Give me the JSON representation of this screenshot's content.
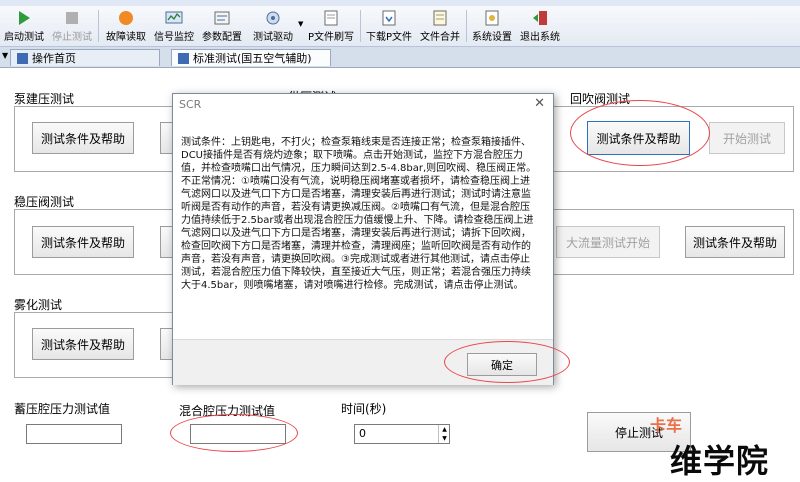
{
  "toolbar": {
    "buttons": [
      {
        "label": "启动测试",
        "icon": "play-icon"
      },
      {
        "label": "停止测试",
        "icon": "stop-icon"
      },
      {
        "label": "故障读取",
        "icon": "fault-read-icon"
      },
      {
        "label": "信号监控",
        "icon": "signal-monitor-icon"
      },
      {
        "label": "参数配置",
        "icon": "param-config-icon"
      },
      {
        "label": "测试驱动",
        "icon": "test-drive-icon"
      },
      {
        "label": "P文件刷写",
        "icon": "pfile-flash-icon"
      },
      {
        "label": "下载P文件",
        "icon": "download-icon"
      },
      {
        "label": "文件合并",
        "icon": "file-merge-icon"
      },
      {
        "label": "系统设置",
        "icon": "settings-icon"
      },
      {
        "label": "退出系统",
        "icon": "exit-icon"
      }
    ]
  },
  "tabs": {
    "home": "操作首页",
    "standard": "标准测试(国五空气辅助)"
  },
  "groups": {
    "pump": {
      "title": "泵建压测试",
      "help_btn": "测试条件及帮助"
    },
    "pressure_hidden": {
      "title": "供压测试"
    },
    "purge": {
      "title": "回吹阀测试",
      "help_btn": "测试条件及帮助",
      "start_btn": "开始测试"
    },
    "regulator": {
      "title": "稳压阀测试",
      "help_btn": "测试条件及帮助"
    },
    "flow": {
      "start_btn": "大流量测试开始",
      "help_btn": "测试条件及帮助"
    },
    "atomize": {
      "title": "雾化测试",
      "help_btn": "测试条件及帮助"
    }
  },
  "bottom": {
    "accum_label": "蓄压腔压力测试值",
    "accum_value": "",
    "mix_label": "混合腔压力测试值",
    "mix_value": "",
    "time_label": "时间(秒)",
    "time_value": "0",
    "stop_btn": "停止测试"
  },
  "dialog": {
    "title": "SCR",
    "close": "✕",
    "body": "测试条件：上钥匙电，不打火；检查泵箱线束是否连接正常；检查泵箱接插件、DCU接插件是否有烧灼迹象；取下喷嘴。点击开始测试，监控下方混合腔压力值，并检查喷嘴口出气情况，压力瞬间达到2.5-4.8bar,则回吹阀、稳压阀正常。不正常情况：①喷嘴口没有气流，说明稳压阀堵塞或者损坏，请检查稳压阀上进气滤网口以及进气口下方口是否堵塞，清理安装后再进行测试；测试时请注意监听阀是否有动作的声音，若没有请更换减压阀。②喷嘴口有气流，但是混合腔压力值持续低于2.5bar或者出现混合腔压力值缓慢上升、下降。请检查稳压阀上进气滤网口以及进气口下方口是否堵塞，清理安装后再进行测试；请拆下回吹阀，检查回吹阀下方口是否堵塞，清理并检查，清理阀座；监听回吹阀是否有动作的声音，若没有声音，请更换回吹阀。③完成测试或者进行其他测试，请点击停止测试，若混合腔压力值下降较快，直至接近大气压，则正常；若混合强压力持续大于4.5bar，则喷嘴堵塞，请对喷嘴进行检修。完成测试，请点击停止测试。",
    "ok_btn": "确定"
  },
  "watermark": {
    "text": "维学院",
    "logo": "卡车"
  }
}
